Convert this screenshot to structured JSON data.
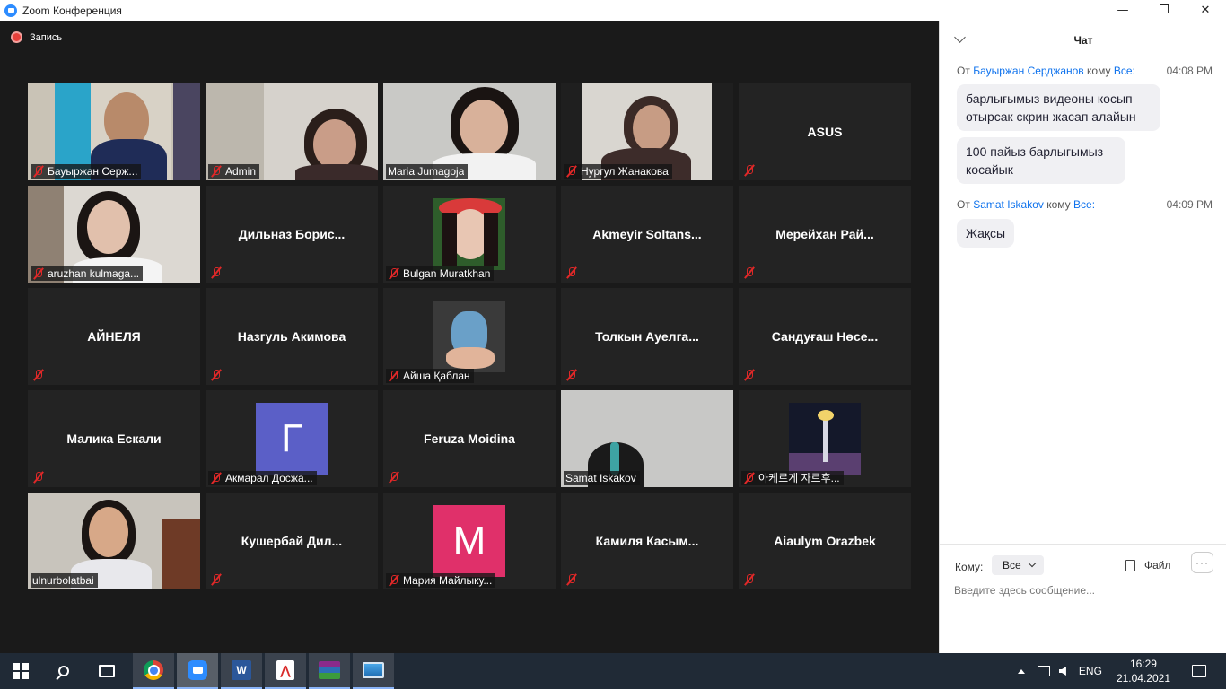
{
  "window": {
    "title": "Zoom Конференция",
    "controls": {
      "minimize": "—",
      "maximize": "❐",
      "close": "✕"
    }
  },
  "recording": {
    "label": "Запись"
  },
  "participants": [
    {
      "name": "Бауыржан Серж...",
      "video": true,
      "scene": "flag",
      "muted": true,
      "active": false
    },
    {
      "name": "Admin",
      "video": true,
      "scene": "woman-glasses",
      "muted": true,
      "active": false
    },
    {
      "name": "Maria Jumagoja",
      "video": true,
      "scene": "woman-center",
      "muted": false,
      "active": true
    },
    {
      "name": "Нургул Жанакова",
      "video": true,
      "scene": "woman-small",
      "muted": true,
      "active": false
    },
    {
      "name": "ASUS",
      "video": false,
      "muted": true,
      "active": false
    },
    {
      "name": "aruzhan kulmaga...",
      "video": true,
      "scene": "girl",
      "muted": true,
      "active": false
    },
    {
      "name": "Дильназ  Борис...",
      "video": false,
      "muted": true,
      "active": false
    },
    {
      "name": "Bulgan Muratkhan",
      "video": true,
      "scene": "photo-flowers",
      "muted": true,
      "active": false
    },
    {
      "name": "Akmeyir  Soltans...",
      "video": false,
      "muted": true,
      "active": false
    },
    {
      "name": "Мерейхан  Рай...",
      "video": false,
      "muted": true,
      "active": false
    },
    {
      "name": "АЙНЕЛЯ",
      "video": false,
      "muted": true,
      "active": false
    },
    {
      "name": "Назгуль Акимова",
      "video": false,
      "muted": true,
      "active": false
    },
    {
      "name": "Айша Қаблан",
      "video": true,
      "scene": "photo-figure",
      "muted": true,
      "active": false
    },
    {
      "name": "Толкын  Ауелга...",
      "video": false,
      "muted": true,
      "active": false
    },
    {
      "name": "Сандуғаш  Нөсе...",
      "video": false,
      "muted": true,
      "active": false
    },
    {
      "name": "Малика Ескали",
      "video": false,
      "muted": true,
      "active": false
    },
    {
      "name": "Акмарал Досжа...",
      "video": true,
      "scene": "letter",
      "letter": "Г",
      "color": "#5b5fc7",
      "muted": true,
      "active": false
    },
    {
      "name": "Feruza Moidina",
      "video": false,
      "muted": true,
      "active": false
    },
    {
      "name": "Samat Iskakov",
      "video": true,
      "scene": "headphones",
      "muted": false,
      "active": false
    },
    {
      "name": "아케르게 자르후...",
      "video": true,
      "scene": "photo-tower",
      "muted": true,
      "active": false
    },
    {
      "name": "ulnurbolatbai",
      "video": true,
      "scene": "girl-speaking",
      "muted": false,
      "active": false
    },
    {
      "name": "Кушербай  Дил...",
      "video": false,
      "muted": true,
      "active": false
    },
    {
      "name": "Мария Майлыку...",
      "video": true,
      "scene": "letter",
      "letter": "M",
      "color": "#e0306a",
      "muted": true,
      "active": false
    },
    {
      "name": "Камиля  Касым...",
      "video": false,
      "muted": true,
      "active": false
    },
    {
      "name": "Aiaulym Orazbek",
      "video": false,
      "muted": true,
      "active": false
    }
  ],
  "chat": {
    "title": "Чат",
    "messages": [
      {
        "from_prefix": "От",
        "sender": "Бауыржан Серджанов",
        "to_prefix": "кому",
        "recipient": "Все:",
        "time": "04:08 PM",
        "bubbles": [
          "барлығымыз видеоны косып отырсак скрин жасап алайын",
          "100 пайыз барлыгымыз косайык"
        ]
      },
      {
        "from_prefix": "От",
        "sender": "Samat Iskakov",
        "to_prefix": "кому",
        "recipient": "Все:",
        "time": "04:09 PM",
        "bubbles": [
          "Жақсы"
        ]
      }
    ],
    "footer": {
      "to_label": "Кому:",
      "to_value": "Все",
      "file_label": "Файл",
      "more_label": "···",
      "input_placeholder": "Введите здесь сообщение..."
    }
  },
  "taskbar": {
    "apps": [
      "start",
      "search",
      "task-view",
      "chrome",
      "zoom",
      "word",
      "acrobat",
      "winrar",
      "image-viewer"
    ],
    "language": "ENG",
    "time": "16:29",
    "date": "21.04.2021"
  }
}
